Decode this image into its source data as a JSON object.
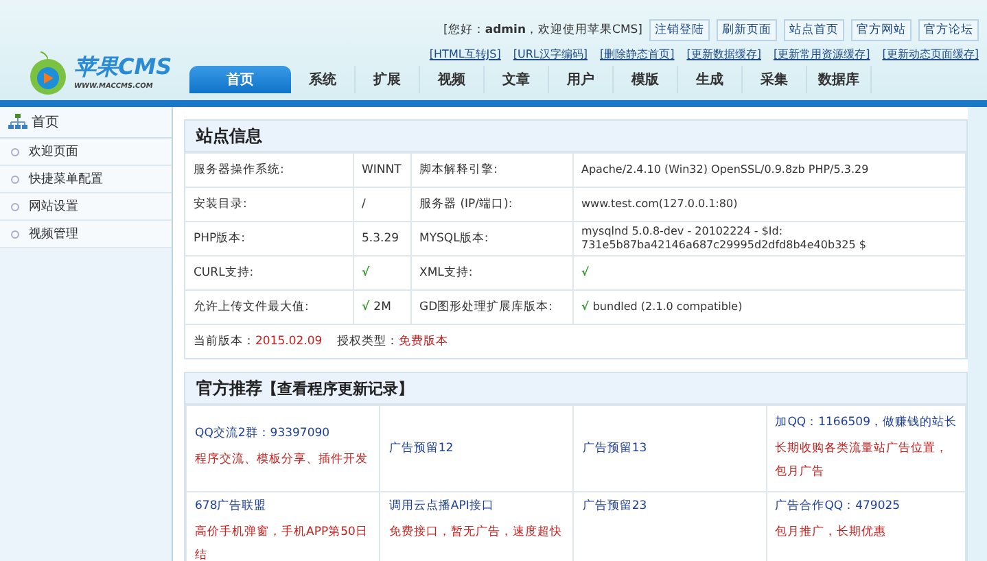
{
  "header": {
    "logo": {
      "name": "苹果CMS",
      "url": "WWW.MACCMS.COM"
    },
    "greeting": "[您好：**admin**，欢迎使用苹果CMS]",
    "buttons": [
      "注销登陆",
      "刷新页面",
      "站点首页",
      "官方网站",
      "官方论坛"
    ],
    "quick_links": [
      "[HTML互转JS]",
      "[URL汉字编码]",
      "[删除静态首页]",
      "[更新数据缓存]",
      "[更新常用资源缓存]",
      "[更新动态页面缓存]"
    ],
    "nav_tabs": [
      {
        "label": "首页",
        "selected": true
      },
      {
        "label": "系统",
        "selected": false
      },
      {
        "label": "扩展",
        "selected": false
      },
      {
        "label": "视频",
        "selected": false
      },
      {
        "label": "文章",
        "selected": false
      },
      {
        "label": "用户",
        "selected": false
      },
      {
        "label": "模版",
        "selected": false
      },
      {
        "label": "生成",
        "selected": false
      },
      {
        "label": "采集",
        "selected": false
      },
      {
        "label": "数据库",
        "selected": false
      }
    ]
  },
  "sidebar": {
    "title": "首页",
    "items": [
      "欢迎页面",
      "快捷菜单配置",
      "网站设置",
      "视频管理"
    ]
  },
  "site_info": {
    "title": "站点信息",
    "rows": [
      {
        "label_1": "服务器操作系统:",
        "value_1": {
          "text": "WINNT"
        },
        "label_2": "脚本解释引擎:",
        "value_2": {
          "text": "Apache/2.4.10 (Win32) OpenSSL/0.9.8zb PHP/5.3.29"
        }
      },
      {
        "label_1": "安装目录:",
        "value_1": {
          "text": "/"
        },
        "label_2": "服务器 (IP/端口):",
        "value_2": {
          "text": "www.test.com(127.0.0.1:80)"
        }
      },
      {
        "label_1": "PHP版本:",
        "value_1": {
          "text": "5.3.29"
        },
        "label_2": "MYSQL版本:",
        "value_2": {
          "text": "mysqlnd 5.0.8-dev - 20102224 - $Id: 731e5b87ba42146a687c29995d2dfd8b4e40b325 $"
        }
      },
      {
        "label_1": "CURL支持:",
        "value_1": {
          "mark": "√"
        },
        "label_2": "XML支持:",
        "value_2": {
          "mark": "√"
        }
      },
      {
        "label_1": "允许上传文件最大值:",
        "value_1": {
          "mark": "√",
          "text": "2M"
        },
        "label_2": "GD图形处理扩展库版本:",
        "value_2": {
          "mark": "√",
          "text": "bundled (2.1.0 compatible)"
        }
      }
    ],
    "version": {
      "label": "当前版本：",
      "value": "2015.02.09",
      "license_label": "授权类型：",
      "license_value": "免费版本"
    }
  },
  "recommend": {
    "title": "官方推荐",
    "link": "【查看程序更新记录】",
    "rows": [
      [
        {
          "title": "QQ交流2群：93397090",
          "desc": "程序交流、模板分享、插件开发"
        },
        {
          "title": "广告预留12"
        },
        {
          "title": "广告预留13"
        },
        {
          "title": "加QQ：1166509，做赚钱的站长",
          "desc": "长期收购各类流量站广告位置，包月广告"
        }
      ],
      [
        {
          "title": "678广告联盟",
          "desc": "高价手机弹窗，手机APP第50日结"
        },
        {
          "title": "调用云点播API接口",
          "desc": "免费接口，暂无广告，速度超快"
        },
        {
          "title": "广告预留23"
        },
        {
          "title": "广告合作QQ：479025",
          "desc": "包月推广，长期优惠"
        }
      ]
    ]
  }
}
